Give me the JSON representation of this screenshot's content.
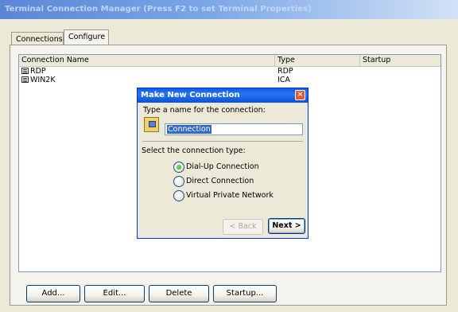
{
  "window": {
    "title": "Terminal Connection Manager (Press F2 to set Terminal Properties)"
  },
  "tabs": [
    {
      "label": "Connections",
      "active": false
    },
    {
      "label": "Configure",
      "active": true
    }
  ],
  "list": {
    "columns": {
      "name": "Connection Name",
      "type": "Type",
      "startup": "Startup"
    },
    "rows": [
      {
        "name": "RDP",
        "type": "RDP",
        "startup": ""
      },
      {
        "name": "WIN2K",
        "type": "ICA",
        "startup": ""
      }
    ]
  },
  "buttons": {
    "add": "Add...",
    "edit": "Edit...",
    "delete": "Delete",
    "startup": "Startup..."
  },
  "dialog": {
    "title": "Make New Connection",
    "close_icon": "close-icon",
    "prompt": "Type a name for the connection:",
    "name_value": "Connection",
    "type_label": "Select the connection type:",
    "options": [
      {
        "label": "Dial-Up Connection",
        "selected": true
      },
      {
        "label": "Direct Connection",
        "selected": false
      },
      {
        "label": "Virtual Private Network",
        "selected": false
      }
    ],
    "back_label": "< Back",
    "next_label": "Next >"
  },
  "colors": {
    "titlebar": "#5a86d6",
    "dialog_titlebar": "#0a5fe6",
    "selection": "#316ac5",
    "face": "#ece9d8",
    "close": "#e35a3a"
  }
}
